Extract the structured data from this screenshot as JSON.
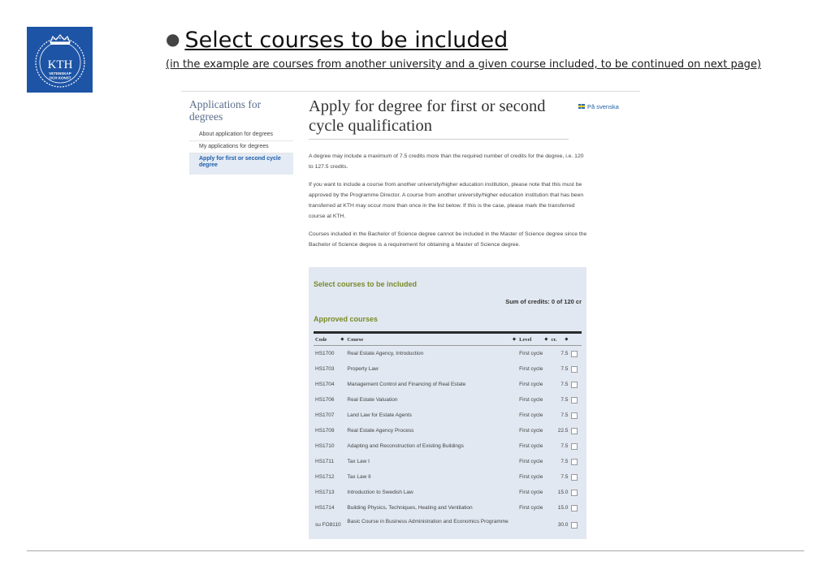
{
  "logo": {
    "text": "KTH",
    "subtext": "VETENSKAP OCH KONST"
  },
  "slide": {
    "title": "Select courses to be included",
    "subtitle": "(in the example are courses from another university and a given course included, to be continued on next page)"
  },
  "sidebar": {
    "title": "Applications for degrees",
    "items": [
      {
        "label": "About application for degrees"
      },
      {
        "label": "My applications for degrees"
      },
      {
        "label": "Apply for first or second cycle degree"
      }
    ]
  },
  "main": {
    "title": "Apply for degree for first or second cycle qualification",
    "lang_link": "På svenska",
    "paragraphs": [
      "A degree may include a maximum of 7.5 credits more than the required number of credits for the degree, i.e. 120 to 127.5 credits.",
      "If you want to include a course from another university/higher education institution, please note that this must be approved by the Programme Director. A course from another university/higher education institution that has been transferred at KTH may occur more than once in the list below. If this is the case, please mark the transferred course at KTH.",
      "Courses included in the Bachelor of Science degree cannot be included in the Master of Science degree since the Bachelor of Science degree is a requirement for obtaining a Master of Science degree."
    ]
  },
  "panel": {
    "title": "Select courses to be included",
    "sum": "Sum of credits: 0 of 120 cr",
    "approved_title": "Approved courses",
    "headers": {
      "code": "Code",
      "course": "Course",
      "level": "Level",
      "credits": "cr."
    },
    "rows": [
      {
        "code": "HS1700",
        "course": "Real Estate Agency, Introduction",
        "level": "First cycle",
        "credits": "7.5"
      },
      {
        "code": "HS1703",
        "course": "Property Law",
        "level": "First cycle",
        "credits": "7.5"
      },
      {
        "code": "HS1704",
        "course": "Management Control and Financing of Real Estate",
        "level": "First cycle",
        "credits": "7.5"
      },
      {
        "code": "HS1706",
        "course": "Real Estate Valuation",
        "level": "First cycle",
        "credits": "7.5"
      },
      {
        "code": "HS1707",
        "course": "Land Law for Estate Agents",
        "level": "First cycle",
        "credits": "7.5"
      },
      {
        "code": "HS1709",
        "course": "Real Estate Agency Process",
        "level": "First cycle",
        "credits": "22.5"
      },
      {
        "code": "HS1710",
        "course": "Adapting and Reconstruction of Existing Buildings",
        "level": "First cycle",
        "credits": "7.5"
      },
      {
        "code": "HS1711",
        "course": "Tax Law I",
        "level": "First cycle",
        "credits": "7.5"
      },
      {
        "code": "HS1712",
        "course": "Tax Law II",
        "level": "First cycle",
        "credits": "7.5"
      },
      {
        "code": "HS1713",
        "course": "Introduction to Swedish Law",
        "level": "First cycle",
        "credits": "15.0"
      },
      {
        "code": "HS1714",
        "course": "Building Physics, Techniques, Heating and Ventilation",
        "level": "First cycle",
        "credits": "15.0"
      },
      {
        "code": "su FO8110",
        "course": "Basic Course in Business Administration and Economics Programme",
        "level": "",
        "credits": "30.0"
      }
    ]
  },
  "colors": {
    "kth_blue": "#1d54a6",
    "link_blue": "#1f5ea8",
    "olive_heading": "#7a8a28",
    "panel_bg": "#e1e8f1"
  }
}
